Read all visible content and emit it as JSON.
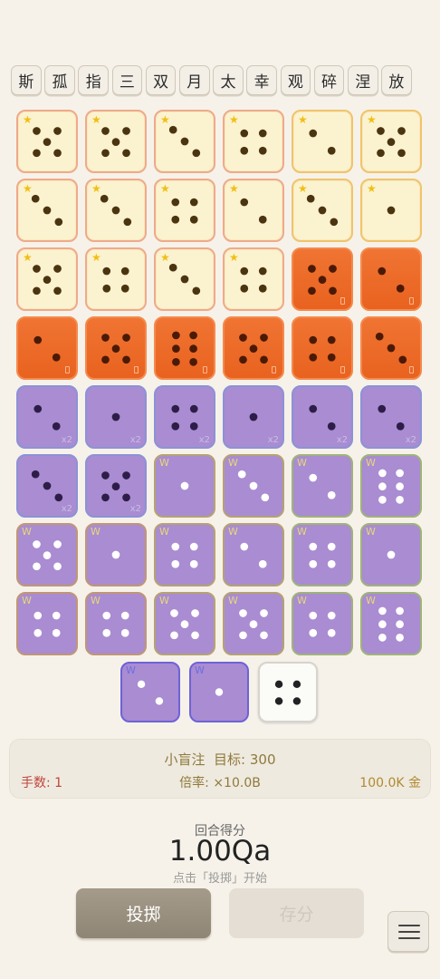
{
  "tags": [
    "斯",
    "孤",
    "指",
    "三",
    "双",
    "月",
    "太",
    "幸",
    "观",
    "碎",
    "涅",
    "放"
  ],
  "colors": {
    "background": "#f6f2e9",
    "cream_die": "#fbf3cf",
    "orange_die": "#e9621f",
    "purple_die": "#a98cd1",
    "star": "#f1be17",
    "hands_text": "#c0453a",
    "gold_text": "#b08a2e"
  },
  "dice": [
    {
      "face": 5,
      "style": "cream",
      "border": "salmon",
      "mark": "★"
    },
    {
      "face": 5,
      "style": "cream",
      "border": "salmon",
      "mark": "★"
    },
    {
      "face": 3,
      "style": "cream",
      "border": "salmon",
      "mark": "★"
    },
    {
      "face": 4,
      "style": "cream",
      "border": "salmon",
      "mark": "★"
    },
    {
      "face": 2,
      "style": "cream",
      "border": "gold",
      "mark": "★"
    },
    {
      "face": 5,
      "style": "cream",
      "border": "gold",
      "mark": "★"
    },
    {
      "face": 3,
      "style": "cream",
      "border": "salmon",
      "mark": "★"
    },
    {
      "face": 3,
      "style": "cream",
      "border": "salmon",
      "mark": "★"
    },
    {
      "face": 4,
      "style": "cream",
      "border": "salmon",
      "mark": "★"
    },
    {
      "face": 2,
      "style": "cream",
      "border": "salmon",
      "mark": "★"
    },
    {
      "face": 3,
      "style": "cream",
      "border": "gold",
      "mark": "★"
    },
    {
      "face": 1,
      "style": "cream",
      "border": "gold",
      "mark": "★"
    },
    {
      "face": 5,
      "style": "cream",
      "border": "salmon",
      "mark": "★"
    },
    {
      "face": 4,
      "style": "cream",
      "border": "salmon",
      "mark": "★"
    },
    {
      "face": 3,
      "style": "cream",
      "border": "salmon",
      "mark": "★"
    },
    {
      "face": 4,
      "style": "cream",
      "border": "salmon",
      "mark": "★"
    },
    {
      "face": 5,
      "style": "orange",
      "mark": "tiny"
    },
    {
      "face": 2,
      "style": "orange",
      "mark": "tiny"
    },
    {
      "face": 2,
      "style": "orange",
      "mark": "tiny"
    },
    {
      "face": 5,
      "style": "orange",
      "mark": "tiny"
    },
    {
      "face": 6,
      "style": "orange",
      "mark": "tiny"
    },
    {
      "face": 5,
      "style": "orange",
      "mark": "tiny"
    },
    {
      "face": 4,
      "style": "orange",
      "mark": "tiny"
    },
    {
      "face": 3,
      "style": "orange",
      "mark": "tiny"
    },
    {
      "face": 2,
      "style": "purple",
      "border": "blue",
      "mark": "x2"
    },
    {
      "face": 1,
      "style": "purple",
      "border": "blue",
      "mark": "x2"
    },
    {
      "face": 4,
      "style": "purple",
      "border": "blue",
      "mark": "x2"
    },
    {
      "face": 1,
      "style": "purple",
      "border": "blue",
      "mark": "x2"
    },
    {
      "face": 2,
      "style": "purple",
      "border": "blue",
      "mark": "x2"
    },
    {
      "face": 2,
      "style": "purple",
      "border": "blue",
      "mark": "x2"
    },
    {
      "face": 3,
      "style": "purple",
      "border": "blue",
      "mark": "x2"
    },
    {
      "face": 5,
      "style": "purple",
      "border": "blue",
      "mark": "x2"
    },
    {
      "face": 1,
      "style": "purple",
      "border": "mix",
      "mark": "W",
      "pip": "white"
    },
    {
      "face": 3,
      "style": "purple",
      "border": "mix",
      "mark": "W",
      "pip": "white"
    },
    {
      "face": 2,
      "style": "purple",
      "border": "green",
      "mark": "W",
      "pip": "white"
    },
    {
      "face": 6,
      "style": "purple",
      "border": "green",
      "mark": "W",
      "pip": "white"
    },
    {
      "face": 5,
      "style": "purple",
      "border": "bronze",
      "mark": "W",
      "pip": "white"
    },
    {
      "face": 1,
      "style": "purple",
      "border": "bronze",
      "mark": "W",
      "pip": "white"
    },
    {
      "face": 4,
      "style": "purple",
      "border": "mix",
      "mark": "W",
      "pip": "white"
    },
    {
      "face": 2,
      "style": "purple",
      "border": "mix",
      "mark": "W",
      "pip": "white"
    },
    {
      "face": 4,
      "style": "purple",
      "border": "green",
      "mark": "W",
      "pip": "white"
    },
    {
      "face": 1,
      "style": "purple",
      "border": "green",
      "mark": "W",
      "pip": "white"
    },
    {
      "face": 4,
      "style": "purple",
      "border": "bronze",
      "mark": "W",
      "pip": "white"
    },
    {
      "face": 4,
      "style": "purple",
      "border": "bronze",
      "mark": "W",
      "pip": "white"
    },
    {
      "face": 5,
      "style": "purple",
      "border": "mix",
      "mark": "W",
      "pip": "white"
    },
    {
      "face": 5,
      "style": "purple",
      "border": "mix",
      "mark": "W",
      "pip": "white"
    },
    {
      "face": 4,
      "style": "purple",
      "border": "green",
      "mark": "W",
      "pip": "white"
    },
    {
      "face": 6,
      "style": "purple",
      "border": "green",
      "mark": "W",
      "pip": "white"
    }
  ],
  "hand": [
    {
      "face": 2,
      "style": "handp",
      "mark": "W",
      "pip": "white"
    },
    {
      "face": 1,
      "style": "handp",
      "mark": "W",
      "pip": "white"
    },
    {
      "face": 4,
      "style": "white",
      "pip": "dark"
    }
  ],
  "info": {
    "blind": "小盲注",
    "target_label": "目标:",
    "target_value": "300",
    "hands": "手数: 1",
    "multiplier": "倍率: ×10.0B",
    "money": "100.0K 金"
  },
  "score": {
    "label": "回合得分",
    "value": "1.00Qa",
    "hint": "点击「投掷」开始"
  },
  "buttons": {
    "roll": "投掷",
    "save": "存分"
  },
  "menu_icon": "hamburger-menu-icon"
}
